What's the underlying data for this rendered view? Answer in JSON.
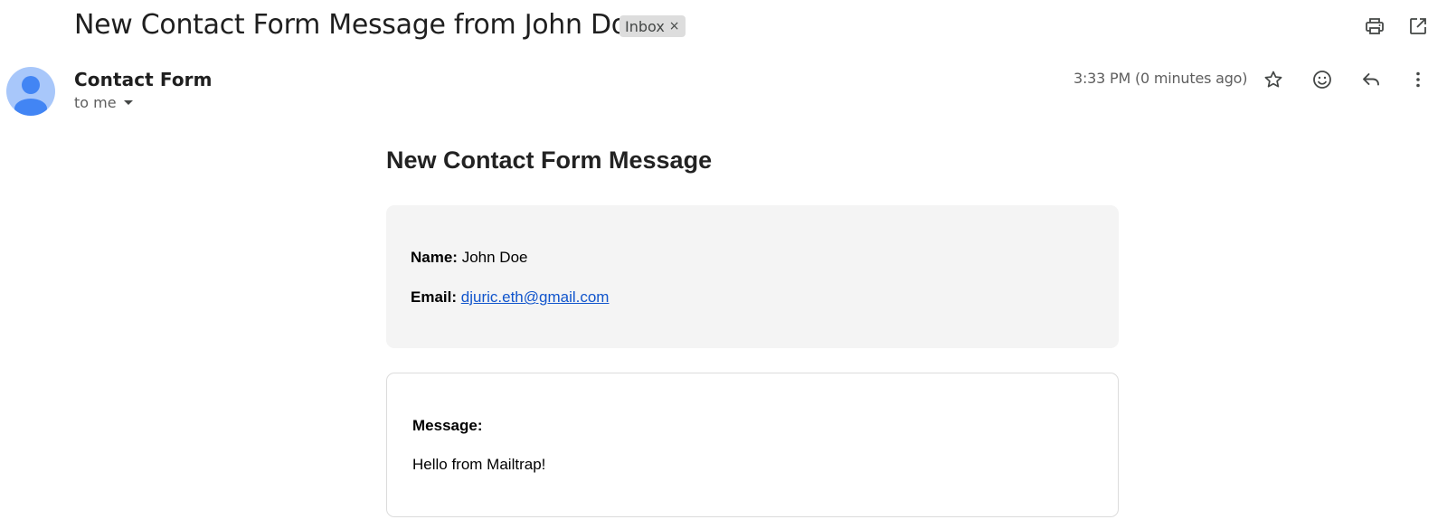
{
  "header": {
    "subject": "New Contact Form Message from John Doe",
    "label": "Inbox",
    "label_remove": "×",
    "actions": [
      "print-icon",
      "open-in-new-window-icon"
    ]
  },
  "sender": {
    "name": "Contact Form",
    "recipient": "to me",
    "timestamp": "3:33 PM (0 minutes ago)",
    "actions": [
      "star-icon",
      "emoji-reaction-icon",
      "reply-icon",
      "more-vert-icon"
    ]
  },
  "email": {
    "title": "New Contact Form Message",
    "name_label": "Name:",
    "name_value": "John Doe",
    "email_label": "Email:",
    "email_value": "djuric.eth@gmail.com",
    "message_label": "Message:",
    "message_body": "Hello from Mailtrap!"
  },
  "colors": {
    "link": "#1155cc",
    "avatar_bg": "#a8c7fa",
    "avatar_fg": "#4285f4",
    "info_box_bg": "#f4f4f4"
  }
}
